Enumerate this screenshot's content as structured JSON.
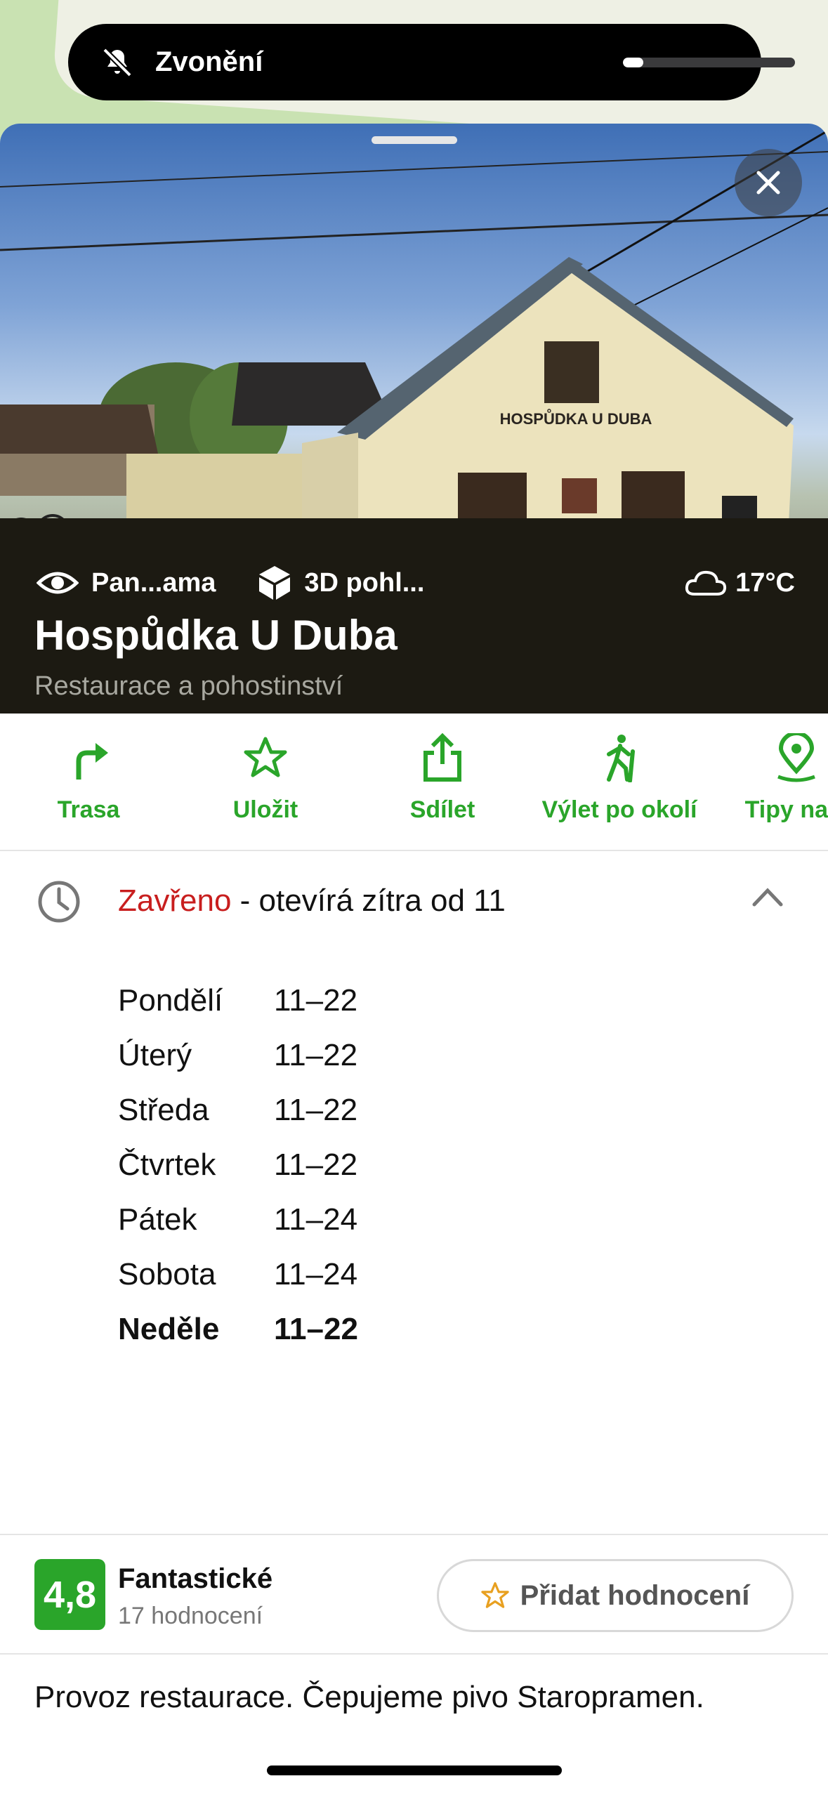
{
  "ringer": {
    "label": "Zvonění",
    "icon": "bell-slash-icon",
    "volume_fraction": 0.12
  },
  "place": {
    "features": [
      {
        "icon": "eye-icon",
        "label": "Pan...ama"
      },
      {
        "icon": "cube-icon",
        "label": "3D pohl..."
      }
    ],
    "weather": {
      "icon": "cloud-icon",
      "label": "17°C"
    },
    "title": "Hospůdka U Duba",
    "category": "Restaurace a pohostinství",
    "sign_text": "HOSPŮDKA U DUBA"
  },
  "actions": [
    {
      "icon": "route-icon",
      "label": "Trasa"
    },
    {
      "icon": "star-icon",
      "label": "Uložit"
    },
    {
      "icon": "share-icon",
      "label": "Sdílet"
    },
    {
      "icon": "hiker-icon",
      "label": "Výlet po okolí"
    },
    {
      "icon": "pin-icon",
      "label": "Tipy na v"
    }
  ],
  "hours": {
    "status_closed": "Zavřeno",
    "status_rest": " - otevírá zítra od 11",
    "days": [
      {
        "day": "Pondělí",
        "time": "11–22"
      },
      {
        "day": "Úterý",
        "time": "11–22"
      },
      {
        "day": "Středa",
        "time": "11–22"
      },
      {
        "day": "Čtvrtek",
        "time": "11–22"
      },
      {
        "day": "Pátek",
        "time": "11–24"
      },
      {
        "day": "Sobota",
        "time": "11–24"
      },
      {
        "day": "Neděle",
        "time": "11–22"
      }
    ]
  },
  "rating": {
    "score": "4,8",
    "word": "Fantastické",
    "count": "17 hodnocení",
    "add_label": "Přidat hodnocení"
  },
  "description": "Provoz restaurace. Čepujeme pivo Staropramen.",
  "colors": {
    "accent": "#2aa52a",
    "closed": "#c81e1e",
    "band": "#1c1a12"
  }
}
